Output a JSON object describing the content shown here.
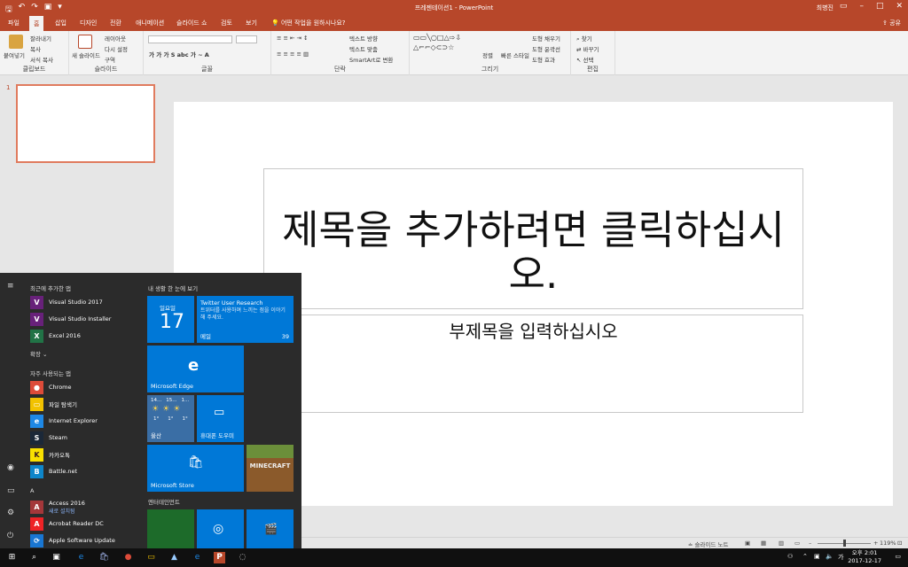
{
  "window": {
    "title": "프레젠테이션1 - PowerPoint",
    "user": "최병진"
  },
  "tabs": [
    {
      "label": "파일"
    },
    {
      "label": "홈"
    },
    {
      "label": "삽입"
    },
    {
      "label": "디자인"
    },
    {
      "label": "전환"
    },
    {
      "label": "애니메이션"
    },
    {
      "label": "슬라이드 쇼"
    },
    {
      "label": "검토"
    },
    {
      "label": "보기"
    }
  ],
  "tell_me": "어떤 작업을 원하시나요?",
  "share": "공유",
  "ribbon": {
    "clipboard": {
      "label": "클립보드",
      "paste": "붙여넣기",
      "cut": "잘라내기",
      "copy": "복사",
      "format_painter": "서식 복사"
    },
    "slides": {
      "label": "슬라이드",
      "new_slide": "새 슬라이드",
      "layout": "레이아웃",
      "reset": "다시 설정",
      "section": "구역"
    },
    "font": {
      "label": "글꼴"
    },
    "paragraph": {
      "label": "단락",
      "text_direction": "텍스트 방향",
      "align_text": "텍스트 맞춤",
      "smartart": "SmartArt로 변환"
    },
    "drawing": {
      "label": "그리기",
      "arrange": "정렬",
      "quick_styles": "빠른 스타일",
      "shape_fill": "도형 채우기",
      "shape_outline": "도형 윤곽선",
      "shape_effects": "도형 효과"
    },
    "editing": {
      "label": "편집",
      "find": "찾기",
      "replace": "바꾸기",
      "select": "선택"
    }
  },
  "slide_panel": {
    "number": "1"
  },
  "slide": {
    "title_placeholder": "제목을 추가하려면 클릭하십시오.",
    "subtitle_placeholder": "부제목을 입력하십시오"
  },
  "status": {
    "notes": "슬라이드 노트",
    "zoom": "119%"
  },
  "start_menu": {
    "recent_header": "최근에 추가한 앱",
    "recent": [
      {
        "name": "Visual Studio 2017",
        "color": "#68217a",
        "glyph": "V"
      },
      {
        "name": "Visual Studio Installer",
        "color": "#68217a",
        "glyph": "V"
      },
      {
        "name": "Excel 2016",
        "color": "#217346",
        "glyph": "X"
      }
    ],
    "expand": "확장",
    "frequent_header": "자주 사용되는 앱",
    "frequent": [
      {
        "name": "Chrome",
        "color": "#dd4b39",
        "glyph": "●"
      },
      {
        "name": "파일 탐색기",
        "color": "#f2c200",
        "glyph": "▭"
      },
      {
        "name": "Internet Explorer",
        "color": "#1e88e5",
        "glyph": "e"
      },
      {
        "name": "Steam",
        "color": "#1b2838",
        "glyph": "S"
      },
      {
        "name": "카카오톡",
        "color": "#f9e000",
        "glyph": "K"
      },
      {
        "name": "Battle.net",
        "color": "#0e86ca",
        "glyph": "B"
      }
    ],
    "letter": "A",
    "apps_a": [
      {
        "name": "Access 2016",
        "sub": "새로 설치됨",
        "color": "#a4373a",
        "glyph": "A"
      },
      {
        "name": "Acrobat Reader DC",
        "color": "#ee2326",
        "glyph": "A"
      },
      {
        "name": "Apple Software Update",
        "color": "#1976d2",
        "glyph": "⟳"
      }
    ],
    "tiles_header": "내 생활 한 눈에 보기",
    "calendar": {
      "day": "일요일",
      "date": "17"
    },
    "mail_tile": {
      "title": "Twitter User Research",
      "body": "트위터를 사용하며 느끼는 점을 이야기해 주세요.",
      "label": "메일",
      "count": "39"
    },
    "edge_tile": "Microsoft Edge",
    "weather_tile": {
      "label": "울산",
      "days": [
        "14...",
        "15...",
        "1..."
      ],
      "temps": [
        "1°",
        "1°",
        "1°"
      ]
    },
    "phone_tile": "휴대폰 도우미",
    "store_tile": "Microsoft Store",
    "minecraft_tile": "MINECRAFT",
    "ent_header": "엔터테인먼트"
  },
  "taskbar": {
    "time": "오후 2:01",
    "date": "2017-12-17",
    "ime": "가"
  }
}
